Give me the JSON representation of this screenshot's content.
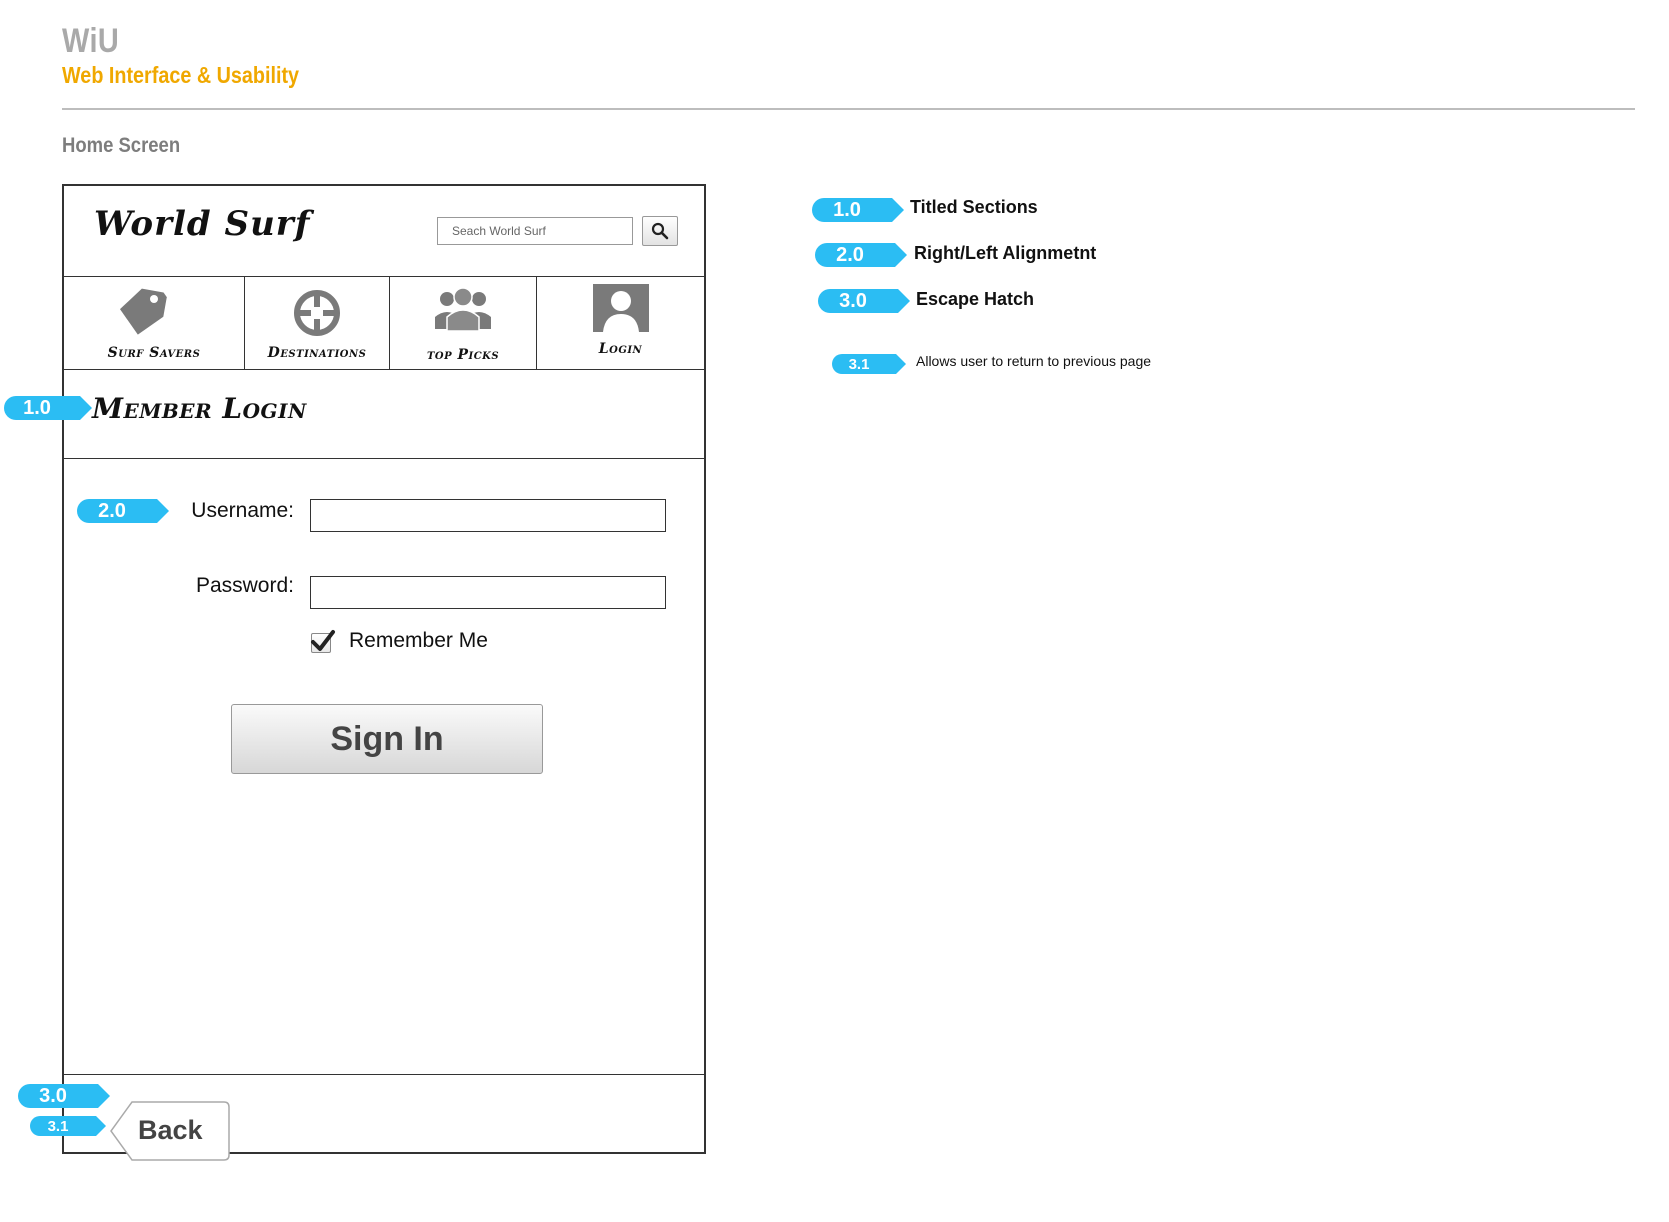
{
  "header": {
    "brand": "WiU",
    "subtitle": "Web Interface & Usability",
    "screen_title": "Home Screen"
  },
  "colors": {
    "accent": "#f0a800",
    "callout": "#2bbdf3",
    "brand_gray": "#a9a9a9"
  },
  "app": {
    "logo": "World Surf",
    "search_placeholder": "Seach World Surf",
    "nav": [
      {
        "label": "Surf Savers",
        "icon": "price-tag-icon"
      },
      {
        "label": "Destinations",
        "icon": "crosshair-icon"
      },
      {
        "label": "top Picks",
        "icon": "group-icon"
      },
      {
        "label": "Login",
        "icon": "user-silhouette-icon"
      }
    ],
    "section_title": "Member Login",
    "form": {
      "username_label": "Username:",
      "password_label": "Password:",
      "remember_label": "Remember Me",
      "remember_checked": true,
      "signin_label": "Sign In"
    },
    "back_label": "Back"
  },
  "callouts": {
    "frame": [
      "1.0",
      "2.0",
      "3.0",
      "3.1"
    ]
  },
  "legend": [
    {
      "id": "1.0",
      "text": "Titled Sections"
    },
    {
      "id": "2.0",
      "text": "Right/Left Alignmetnt"
    },
    {
      "id": "3.0",
      "text": "Escape Hatch"
    },
    {
      "id": "3.1",
      "text": "Allows user to return to previous page"
    }
  ]
}
